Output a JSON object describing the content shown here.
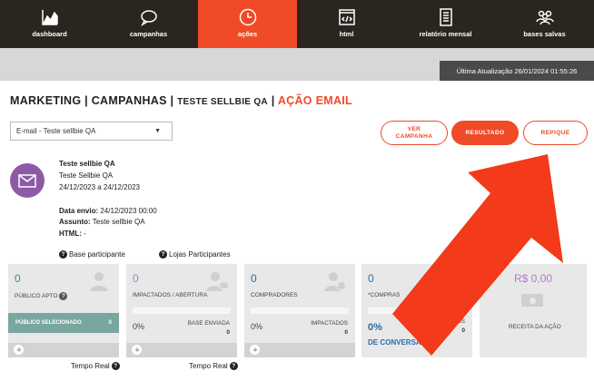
{
  "nav": [
    {
      "label": "dashboard",
      "icon": "chart-area-icon",
      "active": false
    },
    {
      "label": "campanhas",
      "icon": "chat-bubble-icon",
      "active": false
    },
    {
      "label": "ações",
      "icon": "clock-icon",
      "active": true
    },
    {
      "label": "html",
      "icon": "code-window-icon",
      "active": false
    },
    {
      "label": "relatório mensal",
      "icon": "document-icon",
      "active": false
    },
    {
      "label": "bases salvas",
      "icon": "users-icon",
      "active": false
    }
  ],
  "last_update": "Última Atualização 26/01/2024 01:55:26",
  "breadcrumb": {
    "p1": "MARKETING",
    "sep1": " | ",
    "p2": "CAMPANHAS",
    "sep2": " | ",
    "p3": "TESTE SELLBIE QA",
    "sep3": " | ",
    "p4": "AÇÃO EMAIL"
  },
  "select": {
    "value": "E-mail - Teste sellbie QA"
  },
  "buttons": {
    "ver_campanha_1": "VER",
    "ver_campanha_2": "CAMPANHA",
    "resultado": "RESULTADO",
    "repique": "REPIQUE"
  },
  "info": {
    "title": "Teste sellbie QA",
    "subtitle": "Teste Sellbie QA",
    "period": "24/12/2023 a 24/12/2023",
    "data_envio_label": "Data envio:",
    "data_envio": "24/12/2023 00:00",
    "assunto_label": "Assunto:",
    "assunto": "Teste sellbie QA",
    "html_label": "HTML:",
    "html_value": "-"
  },
  "help": {
    "base": "Base participante",
    "lojas": "Lojas Participantes"
  },
  "cards": {
    "c1": {
      "value": "0",
      "label": "PÚBLICO APTO",
      "band": "PÚBLICO SELECIONADO",
      "band_value": "0"
    },
    "c2": {
      "value": "0",
      "label": "IMPACTADOS / ABERTURA",
      "pct": "0%",
      "sub": "BASE ENVIADA",
      "sub_value": "0"
    },
    "c3": {
      "value": "0",
      "label": "COMPRADORES",
      "pct": "0%",
      "sub": "IMPACTADOS",
      "sub_value": "0"
    },
    "c4": {
      "value": "0",
      "label": "*COMPRAS",
      "pct": "0%",
      "pct_label": "DE CONVERSÃO",
      "sub": "IMPACTADOS",
      "sub_value": "0"
    },
    "c5": {
      "value": "R$ 0,00",
      "label": "RECEITA DA AÇÃO"
    }
  },
  "tempo_real": "Tempo Real",
  "colors": {
    "accent": "#f04a28",
    "nav_bg": "#2b2520",
    "purple": "#b37bc6",
    "blue": "#2a6aa8",
    "teal": "#7aa6a0"
  }
}
